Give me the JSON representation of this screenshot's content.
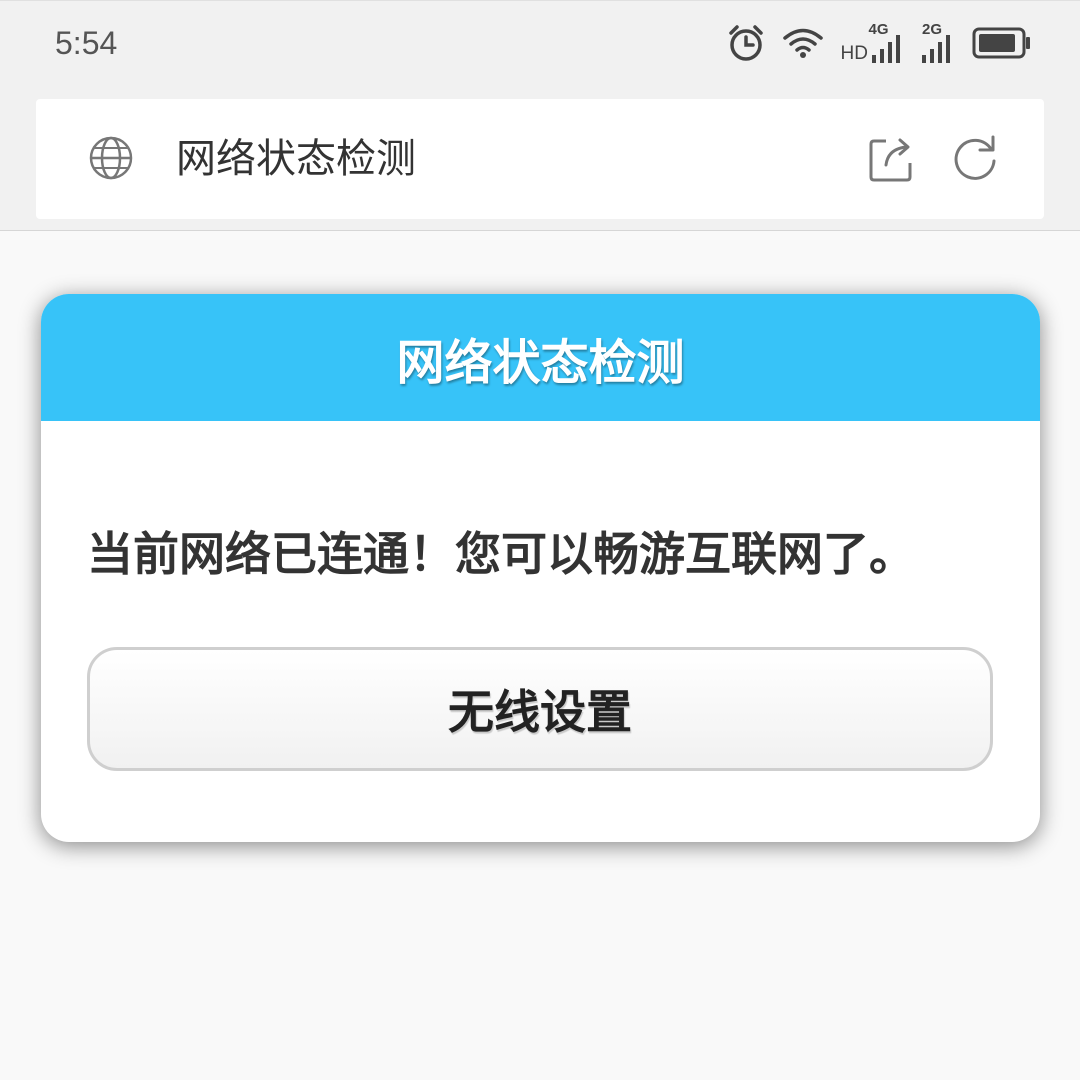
{
  "status_bar": {
    "time": "5:54",
    "signal_1_network": "4G",
    "signal_1_hd": "HD",
    "signal_2_network": "2G",
    "icons": [
      "alarm-icon",
      "wifi-icon",
      "signal-icon",
      "signal-icon",
      "battery-icon"
    ]
  },
  "browser": {
    "page_title": "网络状态检测",
    "icons": [
      "globe-icon",
      "share-icon",
      "refresh-icon"
    ]
  },
  "dialog": {
    "title": "网络状态检测",
    "message": "当前网络已连通！您可以畅游互联网了。",
    "button_label": "无线设置",
    "header_color": "#37c3f8"
  }
}
